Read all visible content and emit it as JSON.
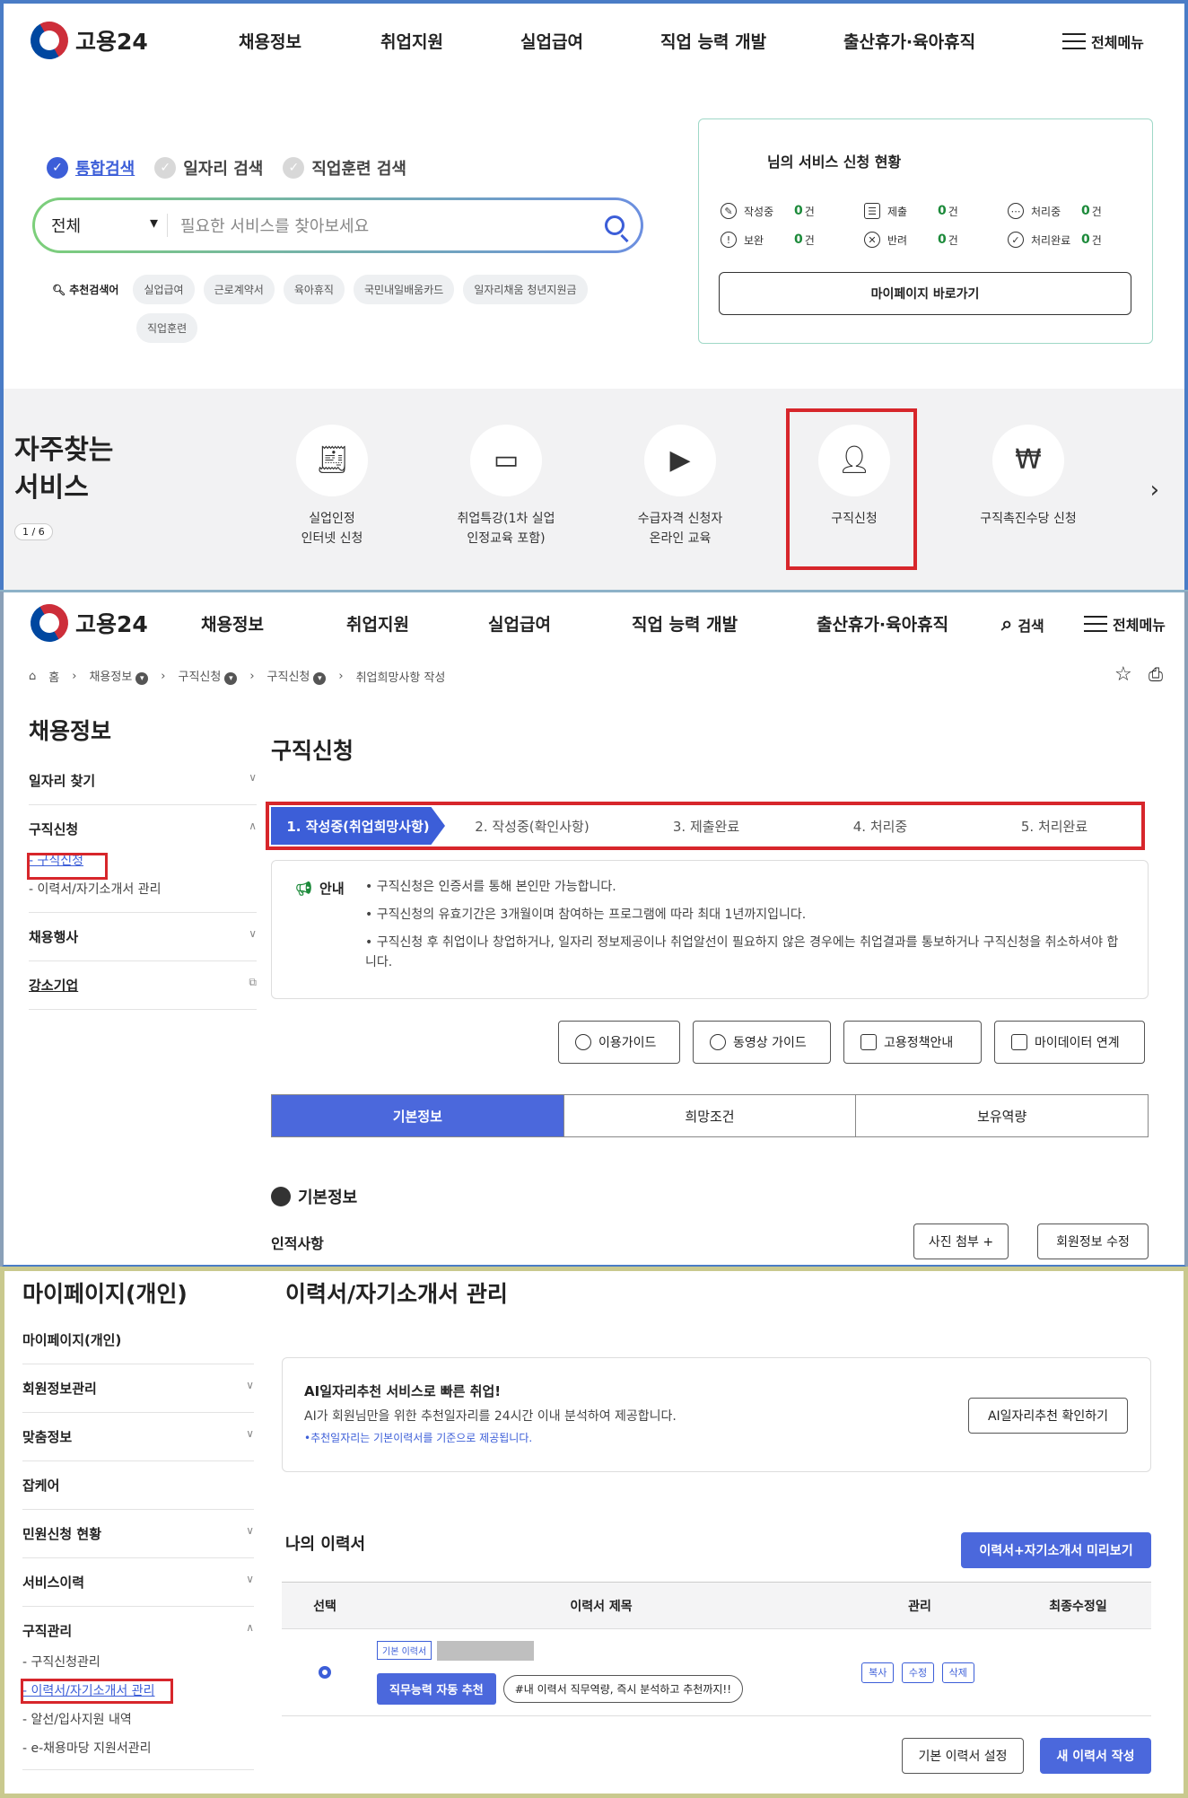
{
  "logo": {
    "text": "고용24"
  },
  "gnav": [
    "채용정보",
    "취업지원",
    "실업급여",
    "직업 능력 개발",
    "출산휴가·육아휴직"
  ],
  "allmenu": "전체메뉴",
  "search_label": "검색",
  "search_modes": [
    "통합검색",
    "일자리 검색",
    "직업훈련 검색"
  ],
  "search": {
    "select": "전체",
    "placeholder": "필요한 서비스를 찾아보세요"
  },
  "recommend": {
    "label": "추천검색어",
    "tags": [
      "실업급여",
      "근로계약서",
      "육아휴직",
      "국민내일배움카드",
      "일자리채움 청년지원금",
      "직업훈련"
    ]
  },
  "status": {
    "title": "님의 서비스 신청 현황",
    "items": [
      {
        "label": "작성중",
        "count": "0",
        "icon": "pencil-icon"
      },
      {
        "label": "제출",
        "count": "0",
        "icon": "checklist-icon"
      },
      {
        "label": "처리중",
        "count": "0",
        "icon": "ellipsis-icon"
      },
      {
        "label": "보완",
        "count": "0",
        "icon": "exclamation-icon"
      },
      {
        "label": "반려",
        "count": "0",
        "icon": "x-circle-icon"
      },
      {
        "label": "처리완료",
        "count": "0",
        "icon": "check-circle-icon"
      }
    ],
    "unit": "건",
    "mypage_button": "마이페이지 바로가기"
  },
  "frequent": {
    "title_line1": "자주찾는",
    "title_line2": "서비스",
    "page": "1 / 6",
    "services": [
      {
        "line1": "실업인정",
        "line2": "인터넷 신청"
      },
      {
        "line1": "취업특강(1차 실업",
        "line2": "인정교육 포함)"
      },
      {
        "line1": "수급자격 신청자",
        "line2": "온라인 교육"
      },
      {
        "line1": "구직신청",
        "line2": ""
      },
      {
        "line1": "구직촉진수당 신청",
        "line2": ""
      }
    ]
  },
  "breadcrumb": [
    "홈",
    "채용정보",
    "구직신청",
    "구직신청",
    "취업희망사항 작성"
  ],
  "side1": {
    "title": "채용정보",
    "items": [
      "일자리 찾기",
      "구직신청",
      "채용행사",
      "강소기업"
    ],
    "subs": [
      "구직신청",
      "이력서/자기소개서 관리"
    ]
  },
  "jobapp": {
    "title": "구직신청",
    "steps": [
      "1. 작성중(취업희망사항)",
      "2. 작성중(확인사항)",
      "3. 제출완료",
      "4. 처리중",
      "5. 처리완료"
    ],
    "notice_label": "안내",
    "notices": [
      "구직신청은 인증서를 통해 본인만 가능합니다.",
      "구직신청의 유효기간은 3개월이며 참여하는 프로그램에 따라 최대 1년까지입니다.",
      "구직신청 후 취업이나 창업하거나, 일자리 정보제공이나 취업알선이 필요하지 않은 경우에는 취업결과를 통보하거나 구직신청을 취소하셔야 합니다."
    ],
    "guide_buttons": [
      "이용가이드",
      "동영상 가이드",
      "고용정책안내",
      "마이데이터 연계"
    ],
    "tabs": [
      "기본정보",
      "희망조건",
      "보유역량"
    ],
    "section": "기본정보",
    "personal": "인적사항",
    "photo_button": "사진 첨부 +",
    "edit_button": "회원정보 수정"
  },
  "side2": {
    "title": "마이페이지(개인)",
    "items": [
      "마이페이지(개인)",
      "회원정보관리",
      "맞춤정보",
      "잡케어",
      "민원신청 현황",
      "서비스이력",
      "구직관리"
    ],
    "subs": [
      "구직신청관리",
      "이력서/자기소개서 관리",
      "알선/입사지원 내역",
      "e-채용마당 지원서관리"
    ]
  },
  "resume": {
    "title": "이력서/자기소개서 관리",
    "ai_title": "AI일자리추천 서비스로 빠른 취업!",
    "ai_desc": "AI가 회원님만을 위한 추천일자리를 24시간 이내 분석하여 제공합니다.",
    "ai_note": "•추천일자리는 기본이력서를 기준으로 제공됩니다.",
    "ai_button": "AI일자리추천 확인하기",
    "my_resume": "나의 이력서",
    "preview_button": "이력서+자기소개서 미리보기",
    "columns": [
      "선택",
      "이력서 제목",
      "관리",
      "최종수정일"
    ],
    "row_badge": "기본 이력서",
    "row_btn": "직무능력 자동 추천",
    "row_hashtag": "#내 이력서 직무역량, 즉시 분석하고 추천까지!!",
    "manage": [
      "복사",
      "수정",
      "삭제"
    ],
    "set_default": "기본 이력서 설정",
    "new_resume": "새 이력서 작성"
  }
}
